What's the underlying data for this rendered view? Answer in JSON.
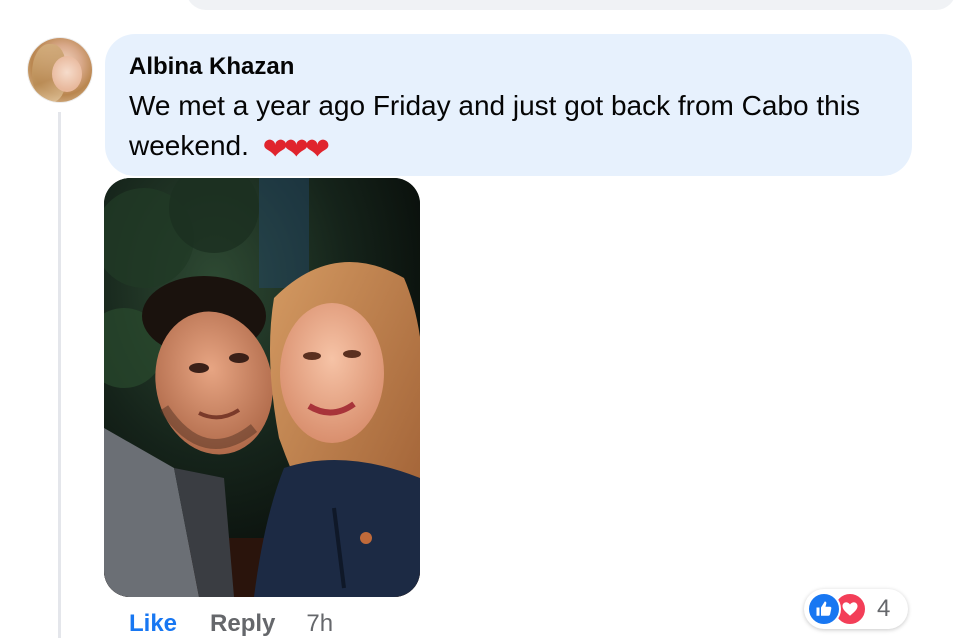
{
  "comment": {
    "author": "Albina Khazan",
    "text": "We met a year ago Friday and just got back from Cabo this weekend.",
    "emoji": "❤❤❤",
    "photo_description_icon": "photo-image"
  },
  "actions": {
    "like_label": "Like",
    "reply_label": "Reply",
    "timestamp": "7h"
  },
  "reactions": {
    "icons": [
      "like-icon",
      "love-icon"
    ],
    "count": "4"
  },
  "colors": {
    "bubble": "#e7f1fd",
    "like_blue": "#1877f2",
    "love_red": "#f33e58",
    "muted": "#65676b"
  }
}
